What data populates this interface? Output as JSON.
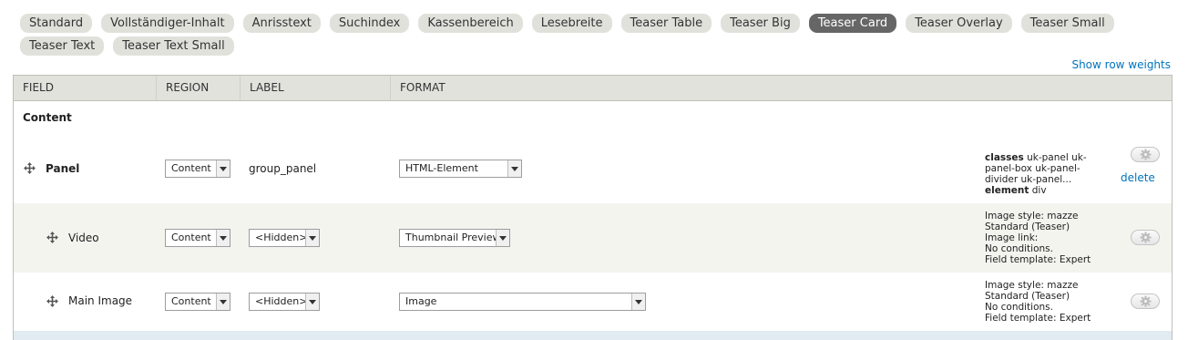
{
  "tabs": [
    {
      "label": "Standard",
      "active": false
    },
    {
      "label": "Vollständiger-Inhalt",
      "active": false
    },
    {
      "label": "Anrisstext",
      "active": false
    },
    {
      "label": "Suchindex",
      "active": false
    },
    {
      "label": "Kassenbereich",
      "active": false
    },
    {
      "label": "Lesebreite",
      "active": false
    },
    {
      "label": "Teaser Table",
      "active": false
    },
    {
      "label": "Teaser Big",
      "active": false
    },
    {
      "label": "Teaser Card",
      "active": true
    },
    {
      "label": "Teaser Overlay",
      "active": false
    },
    {
      "label": "Teaser Small",
      "active": false
    },
    {
      "label": "Teaser Text",
      "active": false
    },
    {
      "label": "Teaser Text Small",
      "active": false
    }
  ],
  "row_weights_link": "Show row weights",
  "table": {
    "headers": {
      "field": "FIELD",
      "region": "REGION",
      "label": "LABEL",
      "format": "FORMAT"
    },
    "section_title": "Content",
    "rows": [
      {
        "field": "Panel",
        "region": "Content",
        "label_text": "group_panel",
        "format": "HTML-Element",
        "summary_label1": "classes",
        "summary_text1": " uk-panel uk-panel-box uk-panel-divider uk-panel...",
        "summary_label2": "element",
        "summary_text2": " div",
        "delete": "delete"
      },
      {
        "field": "Video",
        "region": "Content",
        "label": "<Hidden>",
        "format": "Thumbnail Preview",
        "summary": [
          "Image style: mazze",
          "Standard (Teaser)",
          "Image link:",
          "No conditions.",
          "Field template: Expert"
        ]
      },
      {
        "field": "Main Image",
        "region": "Content",
        "label": "<Hidden>",
        "format": "Image",
        "summary": [
          "Image style: mazze",
          "Standard (Teaser)",
          "No conditions.",
          "Field template: Expert"
        ]
      }
    ]
  },
  "icons": {
    "drag": "move-arrows-icon",
    "settings": "gear-icon"
  },
  "colors": {
    "link": "#0074bd",
    "active_tab": "#666666",
    "tab": "#e1e1dc",
    "alt_row": "#f3f4ee"
  }
}
